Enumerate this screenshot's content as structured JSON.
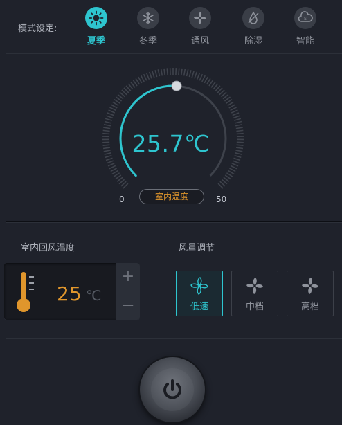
{
  "mode": {
    "label": "模式设定:",
    "items": [
      {
        "label": "夏季",
        "icon": "sun-icon",
        "active": true
      },
      {
        "label": "冬季",
        "icon": "snowflake-icon",
        "active": false
      },
      {
        "label": "通风",
        "icon": "fan-icon",
        "active": false
      },
      {
        "label": "除湿",
        "icon": "dehumidify-icon",
        "active": false
      },
      {
        "label": "智能",
        "icon": "smart-cloud-icon",
        "active": false
      }
    ]
  },
  "dial": {
    "value": "25.7℃",
    "min": "0",
    "max": "50",
    "badge": "室内温度",
    "accent_color": "#2ec5cf"
  },
  "return_air": {
    "title": "室内回风温度",
    "value": "25",
    "unit": "℃",
    "plus": "+",
    "minus": "—"
  },
  "fan_speed": {
    "title": "风量调节",
    "options": [
      {
        "label": "低速",
        "active": true
      },
      {
        "label": "中档",
        "active": false
      },
      {
        "label": "高档",
        "active": false
      }
    ]
  },
  "power": {
    "icon": "power-icon"
  },
  "colors": {
    "accent": "#2ec5cf",
    "warm": "#e0962c",
    "background": "#1f222b"
  }
}
